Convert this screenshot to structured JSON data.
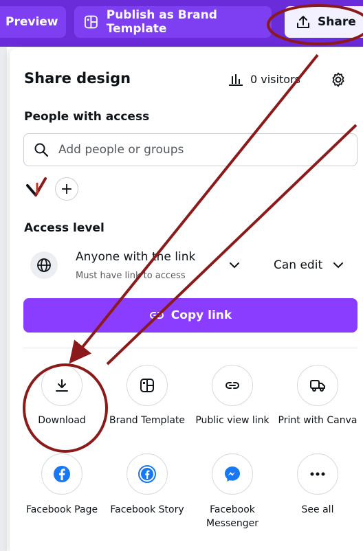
{
  "topbar": {
    "preview_label": "Preview",
    "publish_label": "Publish as Brand Template",
    "share_label": "Share"
  },
  "panel": {
    "title": "Share design",
    "visitors": "0 visitors",
    "people_heading": "People with access",
    "search_placeholder": "Add people or groups",
    "access_heading": "Access level",
    "access_value": "Anyone with the link",
    "access_sub": "Must have link to access",
    "permission_value": "Can edit",
    "copy_link_label": "Copy link"
  },
  "share_options": [
    {
      "label": "Download",
      "icon": "download-icon"
    },
    {
      "label": "Brand Template",
      "icon": "brand-template-icon"
    },
    {
      "label": "Public view link",
      "icon": "link-icon"
    },
    {
      "label": "Print with Canva",
      "icon": "truck-icon"
    },
    {
      "label": "Facebook Page",
      "icon": "facebook-icon"
    },
    {
      "label": "Facebook Story",
      "icon": "facebook-story-icon"
    },
    {
      "label": "Facebook Messenger",
      "icon": "messenger-icon"
    },
    {
      "label": "See all",
      "icon": "more-icon"
    }
  ],
  "colors": {
    "topbar": "#6a2bd9",
    "primary": "#8b3dff",
    "annotation": "#8b1a1a",
    "facebook": "#1877f2"
  }
}
